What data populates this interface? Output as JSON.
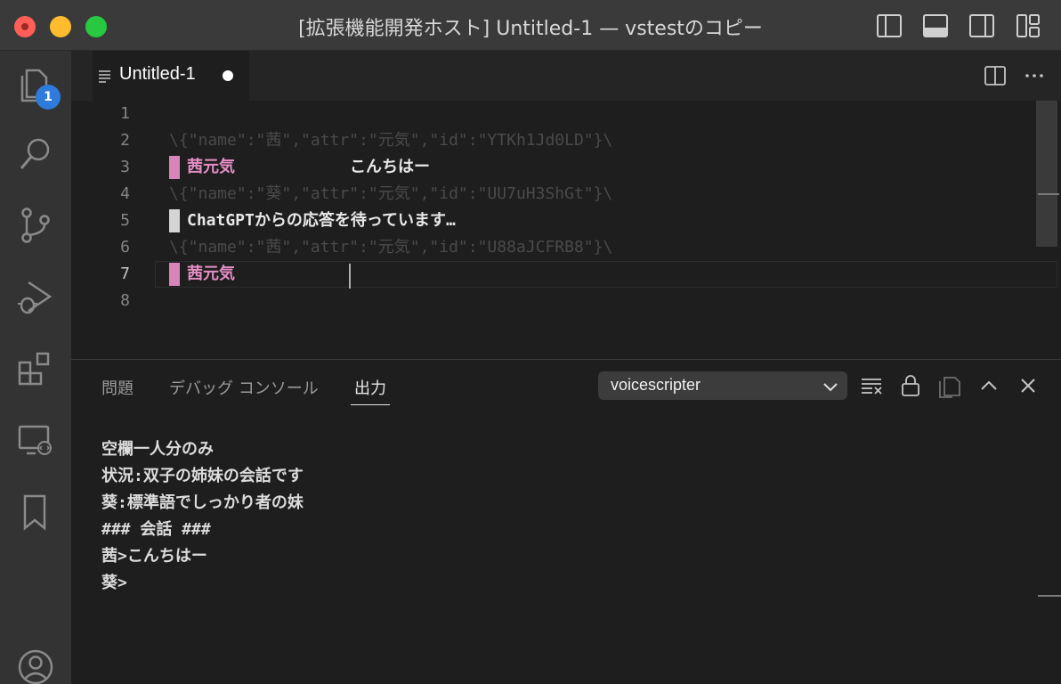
{
  "window": {
    "title": "[拡張機能開発ホスト] Untitled-1 — vstestのコピー",
    "traffic_colors": [
      "#ff5f57",
      "#febc2e",
      "#28c840"
    ]
  },
  "titlebar_icons": [
    "toggle-primary-sidebar-icon",
    "toggle-panel-icon",
    "toggle-secondary-sidebar-icon",
    "customize-layout-icon"
  ],
  "activitybar": {
    "items": [
      {
        "name": "explorer-icon",
        "badge": "1"
      },
      {
        "name": "search-icon"
      },
      {
        "name": "source-control-icon"
      },
      {
        "name": "run-debug-icon"
      },
      {
        "name": "extensions-icon"
      },
      {
        "name": "remote-explorer-icon"
      },
      {
        "name": "bookmarks-icon"
      },
      {
        "name": "accounts-icon"
      }
    ]
  },
  "tabs": [
    {
      "label": "Untitled-1",
      "dirty": true
    }
  ],
  "editor": {
    "lines": [
      {
        "num": "1"
      },
      {
        "num": "2",
        "ghost": "\\{\"name\":\"茜\",\"attr\":\"元気\",\"id\":\"YTKh1Jd0LD\"}\\"
      },
      {
        "num": "3",
        "speaker": "茜元気",
        "speech": "こんちはー",
        "marker": "pink"
      },
      {
        "num": "4",
        "ghost": "\\{\"name\":\"葵\",\"attr\":\"元気\",\"id\":\"UU7uH3ShGt\"}\\"
      },
      {
        "num": "5",
        "speech": "ChatGPTからの応答を待っています…",
        "marker": "white"
      },
      {
        "num": "6",
        "ghost": "\\{\"name\":\"茜\",\"attr\":\"元気\",\"id\":\"U88aJCFRB8\"}\\"
      },
      {
        "num": "7",
        "speaker": "茜元気",
        "marker": "pink",
        "active": true
      },
      {
        "num": "8"
      }
    ],
    "accent_pink": "#d885ba"
  },
  "panel": {
    "tabs": [
      {
        "label": "問題"
      },
      {
        "label": "デバッグ コンソール"
      },
      {
        "label": "出力",
        "active": true
      }
    ],
    "channel": "voicescripter",
    "actions": [
      "clear-output-icon",
      "lock-scroll-icon",
      "open-editor-icon",
      "maximize-panel-icon",
      "close-panel-icon"
    ],
    "output_lines": [
      "空欄一人分のみ",
      "状況:双子の姉妹の会話です",
      "葵:標準語でしっかり者の妹",
      "### 会話 ###",
      "茜>こんちはー",
      "葵>"
    ]
  }
}
